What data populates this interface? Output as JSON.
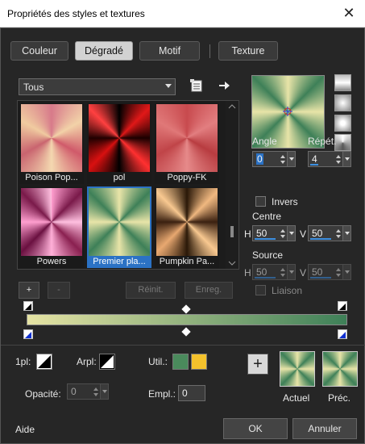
{
  "window": {
    "title": "Propriétés des styles et textures",
    "close": "✕"
  },
  "tabs": [
    "Couleur",
    "Dégradé",
    "Motif",
    "Texture"
  ],
  "category": {
    "value": "Tous"
  },
  "gallery": {
    "items": [
      {
        "label": "Poison Pop..."
      },
      {
        "label": "pol"
      },
      {
        "label": "Poppy-FK"
      },
      {
        "label": "Powers"
      },
      {
        "label": "Premier pla...",
        "selected": true
      },
      {
        "label": "Pumpkin Pa..."
      }
    ]
  },
  "gallery_buttons": {
    "add": "+",
    "remove": "-",
    "reset": "Réinit.",
    "save": "Enreg."
  },
  "angle": {
    "label": "Angle",
    "value": "0"
  },
  "repeat": {
    "label": "Répét.",
    "value": "4"
  },
  "invert": {
    "label": "Invers"
  },
  "center": {
    "label": "Centre",
    "h_label": "H",
    "h": "50",
    "v_label": "V",
    "v": "50"
  },
  "source": {
    "label": "Source",
    "h_label": "H",
    "h": "50",
    "v_label": "V",
    "v": "50"
  },
  "link": {
    "label": "Liaison"
  },
  "gradient": {
    "start_color": "#e6e4a4",
    "end_color": "#3e8058"
  },
  "bottom": {
    "opl_label": "1pl:",
    "arpl_label": "Arpl:",
    "util_label": "Util.:",
    "util_color1": "#4a8a5c",
    "util_color2": "#f4c22c",
    "opacity_label": "Opacité:",
    "opacity_value": "0",
    "location_label": "Empl.:",
    "location_value": "0",
    "add": "+",
    "current_label": "Actuel",
    "previous_label": "Préc."
  },
  "footer": {
    "help": "Aide",
    "ok": "OK",
    "cancel": "Annuler"
  }
}
